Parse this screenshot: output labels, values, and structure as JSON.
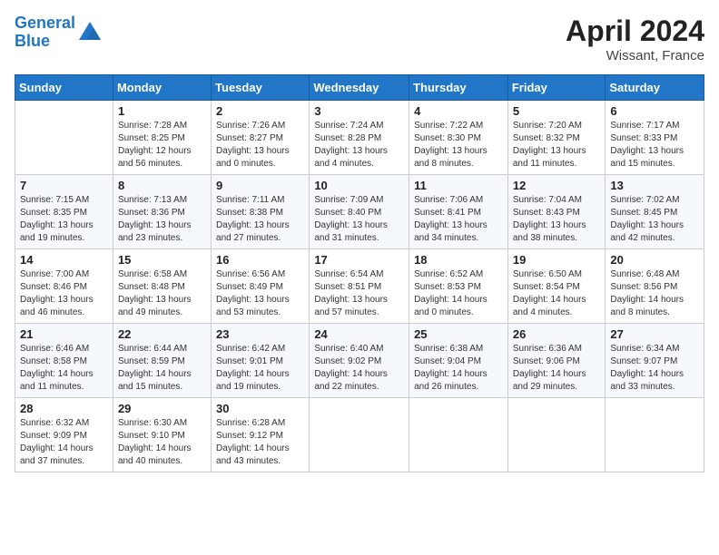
{
  "header": {
    "logo_line1": "General",
    "logo_line2": "Blue",
    "month_year": "April 2024",
    "location": "Wissant, France"
  },
  "weekdays": [
    "Sunday",
    "Monday",
    "Tuesday",
    "Wednesday",
    "Thursday",
    "Friday",
    "Saturday"
  ],
  "weeks": [
    [
      {
        "day": "",
        "sunrise": "",
        "sunset": "",
        "daylight": ""
      },
      {
        "day": "1",
        "sunrise": "Sunrise: 7:28 AM",
        "sunset": "Sunset: 8:25 PM",
        "daylight": "Daylight: 12 hours and 56 minutes."
      },
      {
        "day": "2",
        "sunrise": "Sunrise: 7:26 AM",
        "sunset": "Sunset: 8:27 PM",
        "daylight": "Daylight: 13 hours and 0 minutes."
      },
      {
        "day": "3",
        "sunrise": "Sunrise: 7:24 AM",
        "sunset": "Sunset: 8:28 PM",
        "daylight": "Daylight: 13 hours and 4 minutes."
      },
      {
        "day": "4",
        "sunrise": "Sunrise: 7:22 AM",
        "sunset": "Sunset: 8:30 PM",
        "daylight": "Daylight: 13 hours and 8 minutes."
      },
      {
        "day": "5",
        "sunrise": "Sunrise: 7:20 AM",
        "sunset": "Sunset: 8:32 PM",
        "daylight": "Daylight: 13 hours and 11 minutes."
      },
      {
        "day": "6",
        "sunrise": "Sunrise: 7:17 AM",
        "sunset": "Sunset: 8:33 PM",
        "daylight": "Daylight: 13 hours and 15 minutes."
      }
    ],
    [
      {
        "day": "7",
        "sunrise": "Sunrise: 7:15 AM",
        "sunset": "Sunset: 8:35 PM",
        "daylight": "Daylight: 13 hours and 19 minutes."
      },
      {
        "day": "8",
        "sunrise": "Sunrise: 7:13 AM",
        "sunset": "Sunset: 8:36 PM",
        "daylight": "Daylight: 13 hours and 23 minutes."
      },
      {
        "day": "9",
        "sunrise": "Sunrise: 7:11 AM",
        "sunset": "Sunset: 8:38 PM",
        "daylight": "Daylight: 13 hours and 27 minutes."
      },
      {
        "day": "10",
        "sunrise": "Sunrise: 7:09 AM",
        "sunset": "Sunset: 8:40 PM",
        "daylight": "Daylight: 13 hours and 31 minutes."
      },
      {
        "day": "11",
        "sunrise": "Sunrise: 7:06 AM",
        "sunset": "Sunset: 8:41 PM",
        "daylight": "Daylight: 13 hours and 34 minutes."
      },
      {
        "day": "12",
        "sunrise": "Sunrise: 7:04 AM",
        "sunset": "Sunset: 8:43 PM",
        "daylight": "Daylight: 13 hours and 38 minutes."
      },
      {
        "day": "13",
        "sunrise": "Sunrise: 7:02 AM",
        "sunset": "Sunset: 8:45 PM",
        "daylight": "Daylight: 13 hours and 42 minutes."
      }
    ],
    [
      {
        "day": "14",
        "sunrise": "Sunrise: 7:00 AM",
        "sunset": "Sunset: 8:46 PM",
        "daylight": "Daylight: 13 hours and 46 minutes."
      },
      {
        "day": "15",
        "sunrise": "Sunrise: 6:58 AM",
        "sunset": "Sunset: 8:48 PM",
        "daylight": "Daylight: 13 hours and 49 minutes."
      },
      {
        "day": "16",
        "sunrise": "Sunrise: 6:56 AM",
        "sunset": "Sunset: 8:49 PM",
        "daylight": "Daylight: 13 hours and 53 minutes."
      },
      {
        "day": "17",
        "sunrise": "Sunrise: 6:54 AM",
        "sunset": "Sunset: 8:51 PM",
        "daylight": "Daylight: 13 hours and 57 minutes."
      },
      {
        "day": "18",
        "sunrise": "Sunrise: 6:52 AM",
        "sunset": "Sunset: 8:53 PM",
        "daylight": "Daylight: 14 hours and 0 minutes."
      },
      {
        "day": "19",
        "sunrise": "Sunrise: 6:50 AM",
        "sunset": "Sunset: 8:54 PM",
        "daylight": "Daylight: 14 hours and 4 minutes."
      },
      {
        "day": "20",
        "sunrise": "Sunrise: 6:48 AM",
        "sunset": "Sunset: 8:56 PM",
        "daylight": "Daylight: 14 hours and 8 minutes."
      }
    ],
    [
      {
        "day": "21",
        "sunrise": "Sunrise: 6:46 AM",
        "sunset": "Sunset: 8:58 PM",
        "daylight": "Daylight: 14 hours and 11 minutes."
      },
      {
        "day": "22",
        "sunrise": "Sunrise: 6:44 AM",
        "sunset": "Sunset: 8:59 PM",
        "daylight": "Daylight: 14 hours and 15 minutes."
      },
      {
        "day": "23",
        "sunrise": "Sunrise: 6:42 AM",
        "sunset": "Sunset: 9:01 PM",
        "daylight": "Daylight: 14 hours and 19 minutes."
      },
      {
        "day": "24",
        "sunrise": "Sunrise: 6:40 AM",
        "sunset": "Sunset: 9:02 PM",
        "daylight": "Daylight: 14 hours and 22 minutes."
      },
      {
        "day": "25",
        "sunrise": "Sunrise: 6:38 AM",
        "sunset": "Sunset: 9:04 PM",
        "daylight": "Daylight: 14 hours and 26 minutes."
      },
      {
        "day": "26",
        "sunrise": "Sunrise: 6:36 AM",
        "sunset": "Sunset: 9:06 PM",
        "daylight": "Daylight: 14 hours and 29 minutes."
      },
      {
        "day": "27",
        "sunrise": "Sunrise: 6:34 AM",
        "sunset": "Sunset: 9:07 PM",
        "daylight": "Daylight: 14 hours and 33 minutes."
      }
    ],
    [
      {
        "day": "28",
        "sunrise": "Sunrise: 6:32 AM",
        "sunset": "Sunset: 9:09 PM",
        "daylight": "Daylight: 14 hours and 37 minutes."
      },
      {
        "day": "29",
        "sunrise": "Sunrise: 6:30 AM",
        "sunset": "Sunset: 9:10 PM",
        "daylight": "Daylight: 14 hours and 40 minutes."
      },
      {
        "day": "30",
        "sunrise": "Sunrise: 6:28 AM",
        "sunset": "Sunset: 9:12 PM",
        "daylight": "Daylight: 14 hours and 43 minutes."
      },
      {
        "day": "",
        "sunrise": "",
        "sunset": "",
        "daylight": ""
      },
      {
        "day": "",
        "sunrise": "",
        "sunset": "",
        "daylight": ""
      },
      {
        "day": "",
        "sunrise": "",
        "sunset": "",
        "daylight": ""
      },
      {
        "day": "",
        "sunrise": "",
        "sunset": "",
        "daylight": ""
      }
    ]
  ]
}
